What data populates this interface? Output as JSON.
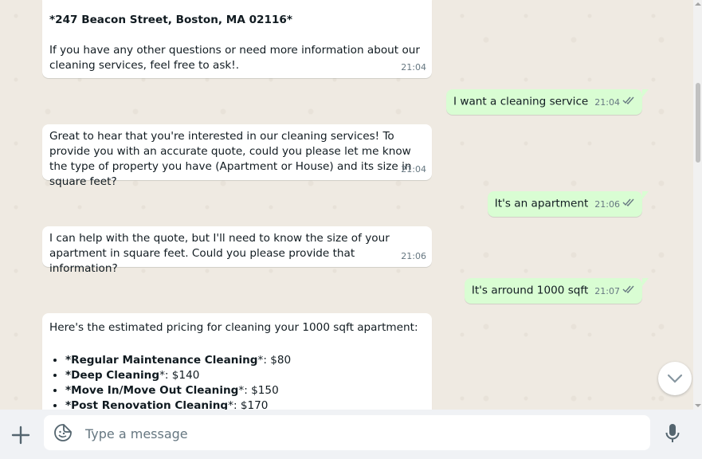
{
  "messages": {
    "m1_address": "*247 Beacon Street, Boston, MA 02116*",
    "m1_text": "If you have any other questions or need more information about our cleaning services, feel free to ask!.",
    "m1_time": "21:04",
    "m2_text": "I want a cleaning service",
    "m2_time": "21:04",
    "m3_text": "Great to hear that you're interested in our cleaning services! To provide you with an accurate quote, could you please let me know the type of property you have (Apartment or House) and its size in square feet?",
    "m3_time": "21:04",
    "m4_text": "It's an apartment",
    "m4_time": "21:06",
    "m5_text": "I can help with the quote, but I'll need to know the size of your apartment in square feet. Could you please provide that information?",
    "m5_time": "21:06",
    "m6_text": "It's arround 1000 sqft",
    "m6_time": "21:07",
    "m7_intro": "Here's the estimated pricing for cleaning your 1000 sqft apartment:",
    "m7_items": [
      {
        "name": "*Regular Maintenance Cleaning",
        "price": "*: $80"
      },
      {
        "name": "*Deep Cleaning",
        "price": "*: $140"
      },
      {
        "name": "*Move In/Move Out Cleaning",
        "price": "*: $150"
      },
      {
        "name": "*Post Renovation Cleaning",
        "price": "*: $170"
      }
    ]
  },
  "composer": {
    "placeholder": "Type a message"
  },
  "icons": {
    "plus": "plus-icon",
    "sticker": "sticker-icon",
    "mic": "microphone-icon",
    "chevron": "chevron-down-icon",
    "ticks": "double-check-icon"
  },
  "colors": {
    "incoming": "#ffffff",
    "outgoing": "#d9fdd3",
    "background": "#efeae2",
    "read_ticks": "#667781"
  }
}
